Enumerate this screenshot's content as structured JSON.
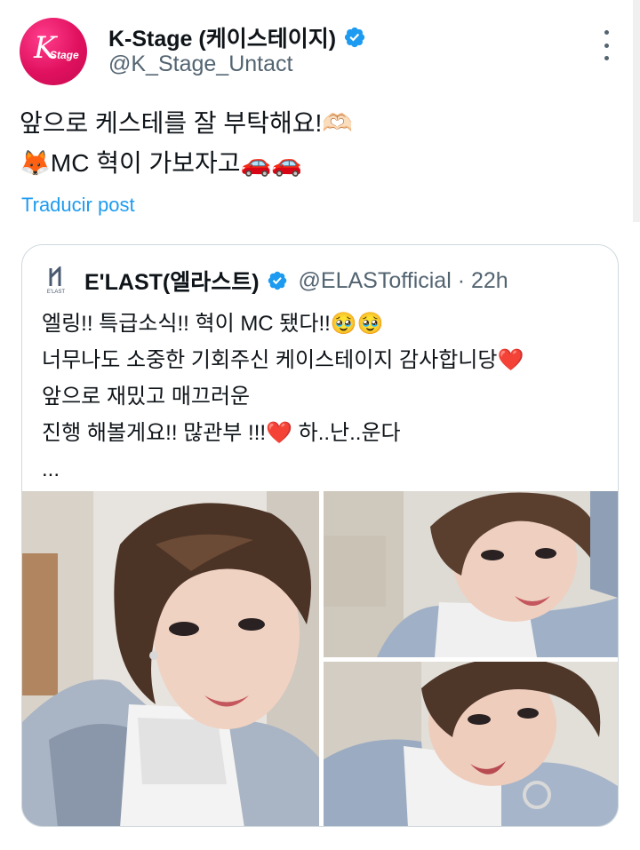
{
  "author": {
    "display_name": "K-Stage (케이스테이지)",
    "handle": "@K_Stage_Untact",
    "avatar_text": "K",
    "avatar_subtext": "Stage"
  },
  "tweet": {
    "lines": [
      "앞으로 케스테를 잘 부탁해요!🫶🏻",
      "🦊MC 혁이 가보자고🚗🚗"
    ],
    "translate_label": "Traducir post"
  },
  "quoted": {
    "display_name": "E'LAST(엘라스트)",
    "handle_time": "@ELASTofficial · 22h",
    "avatar_text": "E'LAST",
    "lines": [
      "엘링!! 특급소식!! 혁이 MC 됐다!!🥹🥹",
      "너무나도 소중한 기회주신 케이스테이지 감사합니당",
      "앞으로 재밌고 매끄러운",
      "진행 해볼게요!! 많관부 !!!",
      "하..난..운다",
      "..."
    ],
    "hearts": [
      "❤️",
      "❤️"
    ]
  },
  "colors": {
    "brand_pink": "#e0115f",
    "link_blue": "#1d9bf0",
    "verified_blue": "#1d9bf0",
    "secondary_text": "#536471",
    "border": "#cfd9de"
  },
  "icons": {
    "verified": "verified-badge-icon",
    "more": "more-vertical-icon"
  }
}
